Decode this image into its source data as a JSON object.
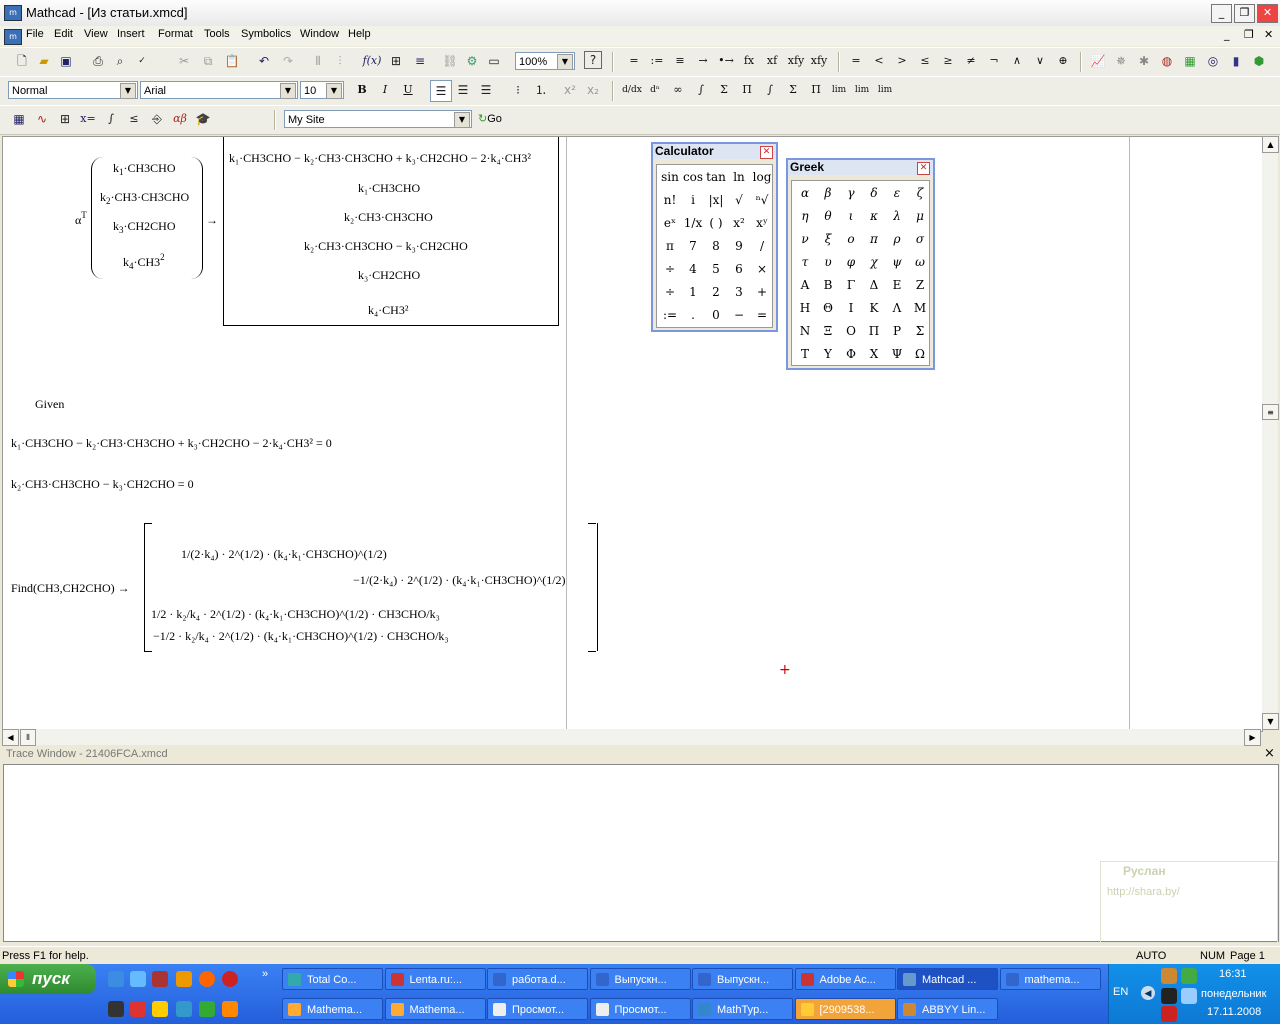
{
  "window": {
    "title": "Mathcad - [Из статьи.xmcd]",
    "app_icon": "mathcad-icon",
    "outer_controls": [
      "_",
      "❐",
      "✕"
    ],
    "inner_controls": [
      "_",
      "❐",
      "✕"
    ]
  },
  "menu": [
    "File",
    "Edit",
    "View",
    "Insert",
    "Format",
    "Tools",
    "Symbolics",
    "Window",
    "Help"
  ],
  "toolbar1": {
    "zoom": "100%",
    "math_ops": [
      "=",
      ":=",
      "≡",
      "→",
      "•→",
      "fx",
      "xf",
      "xfy",
      "xfy"
    ],
    "relations": [
      "=",
      "<",
      ">",
      "≤",
      "≥",
      "≠",
      "¬",
      "∧",
      "∨",
      "⊕"
    ]
  },
  "toolbar2": {
    "style": "Normal",
    "font": "Arial",
    "size": "10",
    "bold": "B",
    "italic": "I",
    "underline": "U"
  },
  "toolbar3": {
    "site": "My Site",
    "go": "Go"
  },
  "worksheet": {
    "alpha": "α",
    "alpha_sup": "T",
    "arrow": "→",
    "vector": [
      {
        "k": "k",
        "i": "1",
        "t": "·CH3CHO",
        "sup": ""
      },
      {
        "k": "k",
        "i": "2",
        "t": "·CH3·CH3CHO",
        "sup": ""
      },
      {
        "k": "k",
        "i": "3",
        "t": "·CH2CHO",
        "sup": ""
      },
      {
        "k": "k",
        "i": "4",
        "t": "·CH3",
        "sup": "2"
      }
    ],
    "result_rows": [
      "k₁·CH3CHO − k₂·CH3·CH3CHO + k₃·CH2CHO − 2·k₄·CH3²",
      "k₁·CH3CHO",
      "k₂·CH3·CH3CHO",
      "k₂·CH3·CH3CHO − k₃·CH2CHO",
      "k₃·CH2CHO",
      "k₄·CH3²"
    ],
    "given": "Given",
    "eq1": "k₁·CH3CHO − k₂·CH3·CH3CHO + k₃·CH2CHO − 2·k₄·CH3² = 0",
    "eq2": "k₂·CH3·CH3CHO − k₃·CH2CHO = 0",
    "find_label": "Find(CH3,CH2CHO) →",
    "find": {
      "r1c1": "1/(2·k₄) · 2^(1/2) · (k₄·k₁·CH3CHO)^(1/2)",
      "r1c2": "−1/(2·k₄) · 2^(1/2) · (k₄·k₁·CH3CHO)^(1/2)",
      "r2c1": "1/2 · k₂/k₄ · 2^(1/2) · (k₄·k₁·CH3CHO)^(1/2) · CH3CHO/k₃",
      "r2c2": "−1/2 · k₂/k₄ · 2^(1/2) · (k₄·k₁·CH3CHO)^(1/2) · CH3CHO/k₃"
    },
    "cursor": "+"
  },
  "calculator": {
    "title": "Calculator",
    "keys": [
      "sin",
      "cos",
      "tan",
      "ln",
      "log",
      "n!",
      "i",
      "|x|",
      "√",
      "ⁿ√",
      "eˣ",
      "1/x",
      "( )",
      "x²",
      "xʸ",
      "π",
      "7",
      "8",
      "9",
      "/",
      "÷",
      "4",
      "5",
      "6",
      "×",
      "÷",
      "1",
      "2",
      "3",
      "+",
      ":=",
      ".",
      "0",
      "−",
      "="
    ]
  },
  "greek": {
    "title": "Greek",
    "letters": [
      "α",
      "β",
      "γ",
      "δ",
      "ε",
      "ζ",
      "η",
      "θ",
      "ι",
      "κ",
      "λ",
      "μ",
      "ν",
      "ξ",
      "ο",
      "π",
      "ρ",
      "σ",
      "τ",
      "υ",
      "φ",
      "χ",
      "ψ",
      "ω",
      "Α",
      "Β",
      "Γ",
      "Δ",
      "Ε",
      "Ζ",
      "Η",
      "Θ",
      "Ι",
      "Κ",
      "Λ",
      "Μ",
      "Ν",
      "Ξ",
      "Ο",
      "Π",
      "Ρ",
      "Σ",
      "Τ",
      "Υ",
      "Φ",
      "Χ",
      "Ψ",
      "Ω"
    ]
  },
  "trace": {
    "title": "Trace Window - 21406FCA.xmcd",
    "close": "×"
  },
  "statusbar": {
    "help": "Press F1 for help.",
    "auto": "AUTO",
    "num": "NUM",
    "page": "Page 1"
  },
  "watermark": {
    "name": "Руслан",
    "url": "http://shara.by/"
  },
  "taskbar": {
    "start": "пуск",
    "row1": [
      "Total Co...",
      "Lenta.ru:...",
      "работа.d...",
      "Выпускн...",
      "Выпускн...",
      "Adobe Ac...",
      "Mathcad ...",
      "mathema..."
    ],
    "row2": [
      "Mathema...",
      "Mathema...",
      "Просмот...",
      "Просмот...",
      "MathTyp...",
      "[2909538...",
      "ABBYY Lin..."
    ],
    "lang": "EN",
    "time": "16:31",
    "day": "понедельник",
    "date": "17.11.2008"
  }
}
